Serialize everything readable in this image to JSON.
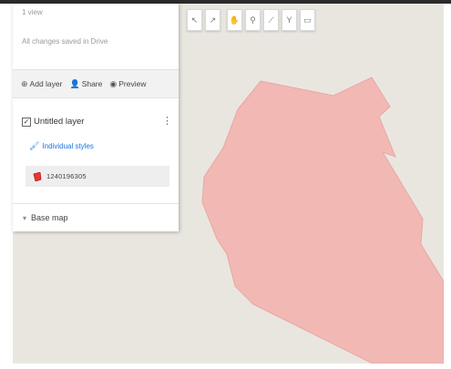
{
  "panel": {
    "views": "1 view",
    "saved_status": "All changes saved in Drive",
    "actions": [
      {
        "label": "Add layer",
        "icon": "add-layer-icon"
      },
      {
        "label": "Share",
        "icon": "share-icon"
      },
      {
        "label": "Preview",
        "icon": "preview-icon"
      }
    ],
    "layer": {
      "title": "Untitled layer",
      "checked": true,
      "styles_label": "Individual styles",
      "feature_label": "1240196305"
    },
    "base_map_label": "Base map"
  },
  "toolbar": {
    "tools": [
      "undo-icon",
      "redo-icon",
      "hand-icon",
      "marker-icon",
      "line-icon",
      "route-icon",
      "ruler-icon"
    ]
  },
  "map": {
    "polygon_fill": "#f2b8b4",
    "polygon_stroke": "#e9a8a3",
    "background": "#e9e6e0"
  }
}
